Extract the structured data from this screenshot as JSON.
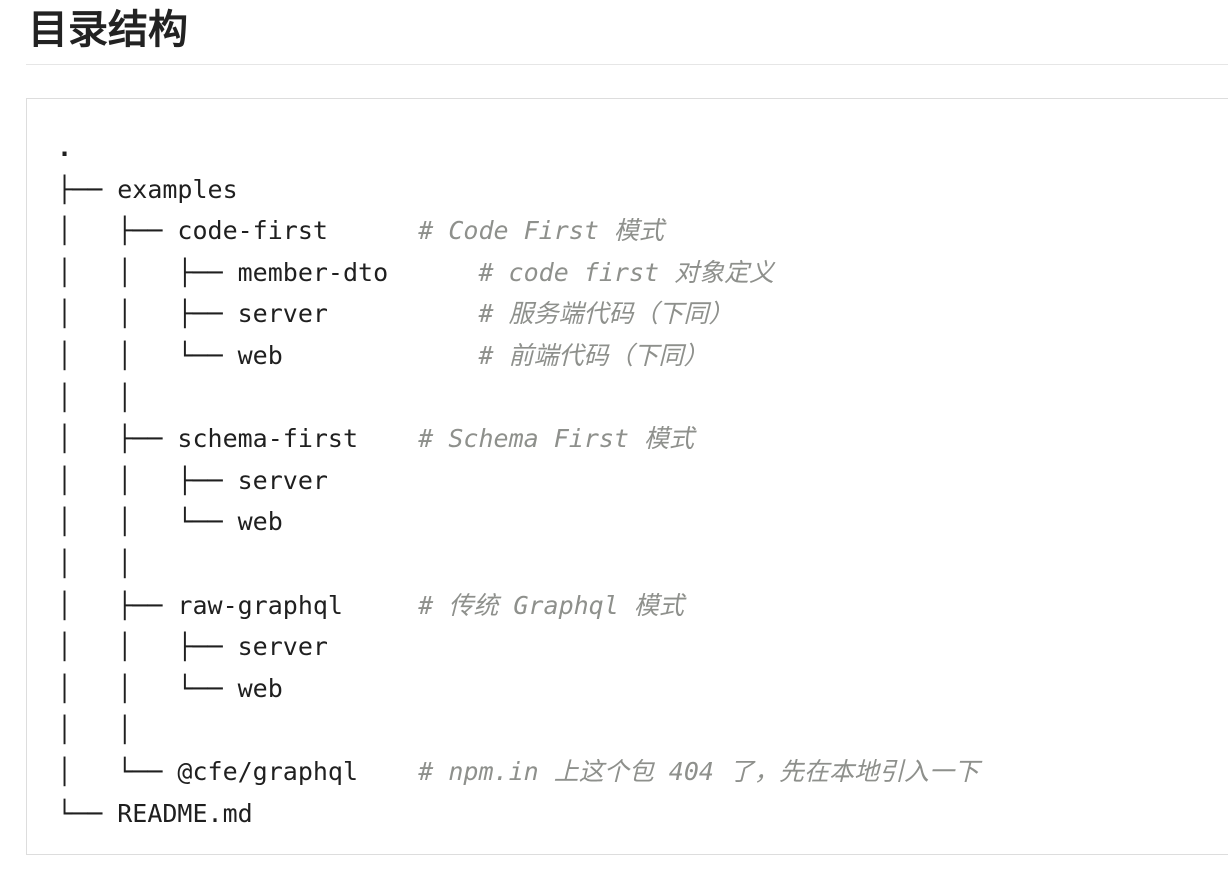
{
  "document": {
    "heading": "目录结构"
  },
  "code": {
    "lines": [
      {
        "tree": "",
        "name": ".",
        "pad": "",
        "comment": ""
      },
      {
        "tree": "├── ",
        "name": "examples",
        "pad": "",
        "comment": ""
      },
      {
        "tree": "│   ├── ",
        "name": "code-first",
        "pad": "      ",
        "comment": "# Code First 模式"
      },
      {
        "tree": "│   │   ├── ",
        "name": "member-dto",
        "pad": "      ",
        "comment": "# code first 对象定义"
      },
      {
        "tree": "│   │   ├── ",
        "name": "server",
        "pad": "          ",
        "comment": "# 服务端代码（下同）"
      },
      {
        "tree": "│   │   └── ",
        "name": "web",
        "pad": "             ",
        "comment": "# 前端代码（下同）"
      },
      {
        "tree": "│   │",
        "name": "",
        "pad": "",
        "comment": ""
      },
      {
        "tree": "│   ├── ",
        "name": "schema-first",
        "pad": "    ",
        "comment": "# Schema First 模式"
      },
      {
        "tree": "│   │   ├── ",
        "name": "server",
        "pad": "",
        "comment": ""
      },
      {
        "tree": "│   │   └── ",
        "name": "web",
        "pad": "",
        "comment": ""
      },
      {
        "tree": "│   │",
        "name": "",
        "pad": "",
        "comment": ""
      },
      {
        "tree": "│   ├── ",
        "name": "raw-graphql",
        "pad": "     ",
        "comment": "# 传统 Graphql 模式"
      },
      {
        "tree": "│   │   ├── ",
        "name": "server",
        "pad": "",
        "comment": ""
      },
      {
        "tree": "│   │   └── ",
        "name": "web",
        "pad": "",
        "comment": ""
      },
      {
        "tree": "│   │",
        "name": "",
        "pad": "",
        "comment": ""
      },
      {
        "tree": "│   └── ",
        "name": "@cfe/graphql",
        "pad": "    ",
        "comment": "# npm.in 上这个包 404 了，先在本地引入一下"
      },
      {
        "tree": "└── ",
        "name": "README.md",
        "pad": "",
        "comment": ""
      }
    ]
  }
}
